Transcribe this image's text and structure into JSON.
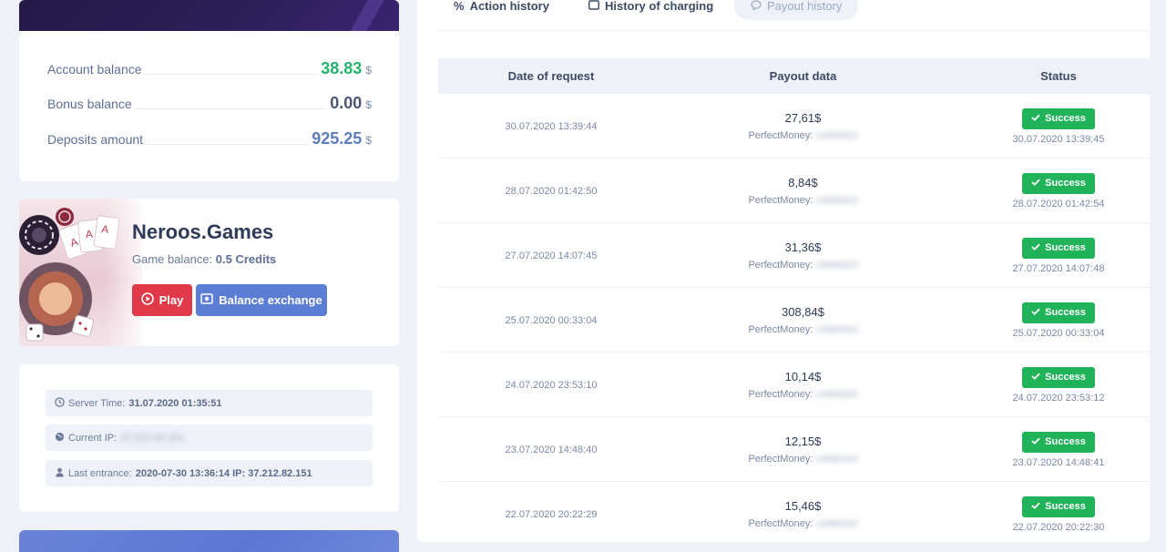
{
  "balances": {
    "account": {
      "label": "Account balance",
      "value": "38.83",
      "currency": "$"
    },
    "bonus": {
      "label": "Bonus balance",
      "value": "0.00",
      "currency": "$"
    },
    "deposits": {
      "label": "Deposits amount",
      "value": "925.25",
      "currency": "$"
    }
  },
  "game": {
    "title": "Neroos.Games",
    "balance_label": "Game balance:",
    "balance_value": "0.5 Credits",
    "play_label": "Play",
    "exchange_label": "Balance exchange"
  },
  "info": {
    "server_time_label": "Server Time:",
    "server_time_value": "31.07.2020 01:35:51",
    "current_ip_label": "Current IP:",
    "current_ip_value": "37.212.82.151",
    "last_entrance_label": "Last entrance:",
    "last_entrance_value": "2020-07-30 13:36:14 IP: 37.212.82.151"
  },
  "tabs": [
    {
      "label": "Action history",
      "active": false
    },
    {
      "label": "History of charging",
      "active": false
    },
    {
      "label": "Payout history",
      "active": true
    }
  ],
  "table": {
    "headers": [
      "Date of request",
      "Payout data",
      "Status"
    ],
    "rows": [
      {
        "date": "30.07.2020 13:39:44",
        "amount": "27,61$",
        "system": "PerfectMoney:",
        "account": "U4993323",
        "status": "Success",
        "status_date": "30.07.2020 13:39:45"
      },
      {
        "date": "28.07.2020 01:42:50",
        "amount": "8,84$",
        "system": "PerfectMoney:",
        "account": "U4993323",
        "status": "Success",
        "status_date": "28.07.2020 01:42:54"
      },
      {
        "date": "27.07.2020 14:07:45",
        "amount": "31,36$",
        "system": "PerfectMoney:",
        "account": "U4993323",
        "status": "Success",
        "status_date": "27.07.2020 14:07:48"
      },
      {
        "date": "25.07.2020 00:33:04",
        "amount": "308,84$",
        "system": "PerfectMoney:",
        "account": "U4993323",
        "status": "Success",
        "status_date": "25.07.2020 00:33:04"
      },
      {
        "date": "24.07.2020 23:53:10",
        "amount": "10,14$",
        "system": "PerfectMoney:",
        "account": "U4993323",
        "status": "Success",
        "status_date": "24.07.2020 23:53:12"
      },
      {
        "date": "23.07.2020 14:48:40",
        "amount": "12,15$",
        "system": "PerfectMoney:",
        "account": "U4993323",
        "status": "Success",
        "status_date": "23.07.2020 14:48:41"
      },
      {
        "date": "22.07.2020 20:22:29",
        "amount": "15,46$",
        "system": "PerfectMoney:",
        "account": "U4993323",
        "status": "Success",
        "status_date": "22.07.2020 20:22:30"
      }
    ]
  },
  "colors": {
    "success": "#21b35a",
    "play": "#e0394a",
    "exchange": "#5b7dd4",
    "account_value": "#23b36b"
  }
}
